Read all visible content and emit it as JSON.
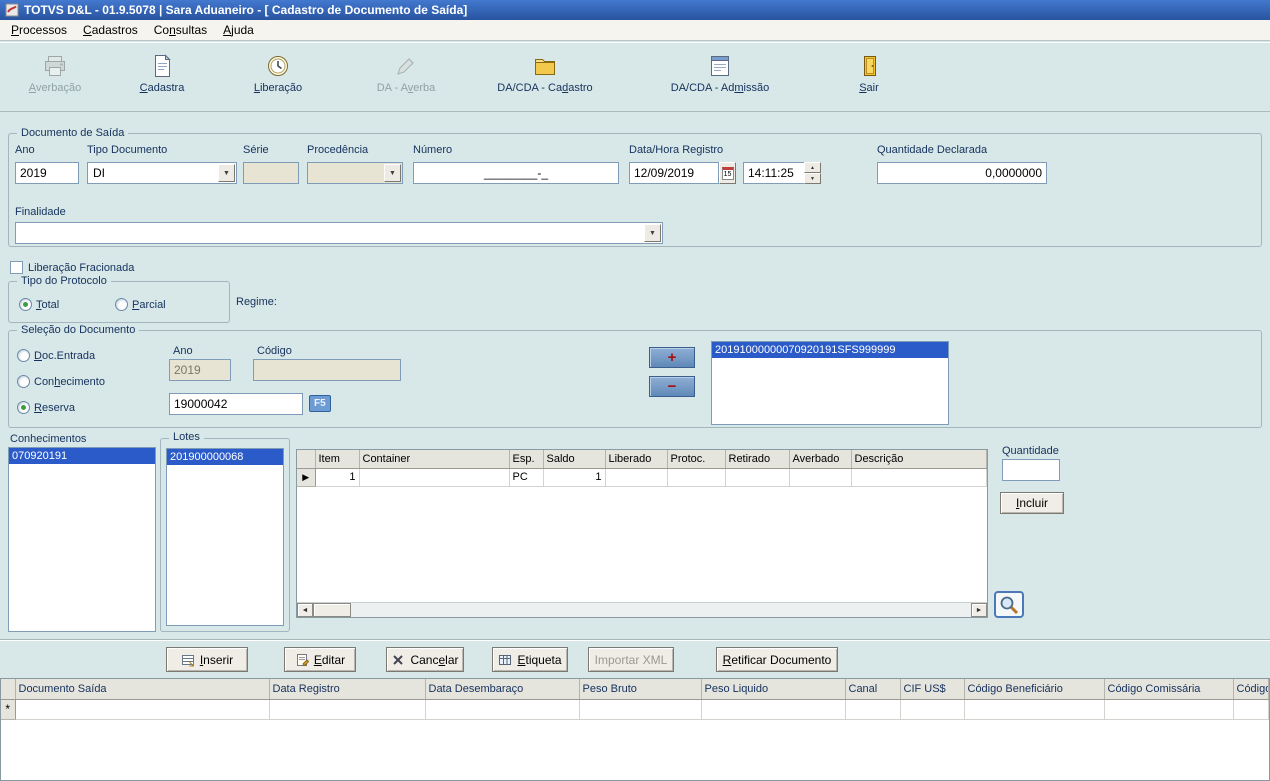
{
  "icons": {
    "dropdown_arrow": "▼",
    "spin_up": "▲",
    "spin_down": "▼",
    "scroll_left": "◄",
    "scroll_right": "►",
    "row_marker": "▶"
  },
  "window": {
    "title": "TOTVS D&L - 01.9.5078 | Sara Aduaneiro - [ Cadastro de Documento de Saída]"
  },
  "menubar": {
    "items": [
      {
        "label": "Processos",
        "hotkey": 0
      },
      {
        "label": "Cadastros",
        "hotkey": 0
      },
      {
        "label": "Consultas",
        "hotkey": 2
      },
      {
        "label": "Ajuda",
        "hotkey": 0
      }
    ]
  },
  "toolbar": {
    "buttons": [
      {
        "label": "Averbação",
        "hotkey": 0,
        "disabled": true
      },
      {
        "label": "Cadastra",
        "hotkey": 0,
        "disabled": false
      },
      {
        "label": "Liberação",
        "hotkey": 0,
        "disabled": false
      },
      {
        "label": "DA - Averba",
        "hotkey": 6,
        "disabled": true
      },
      {
        "label": "DA/CDA - Cadastro",
        "hotkey": 11,
        "disabled": false
      },
      {
        "label": "DA/CDA - Admissão",
        "hotkey": 11,
        "disabled": false
      },
      {
        "label": "Sair",
        "hotkey": 0,
        "disabled": false
      }
    ]
  },
  "documento_saida": {
    "group_title": "Documento de Saída",
    "ano_label": "Ano",
    "ano_value": "2019",
    "tipo_documento_label": "Tipo Documento",
    "tipo_documento_value": "DI",
    "serie_label": "Série",
    "serie_value": "",
    "procedencia_label": "Procedência",
    "procedencia_value": "",
    "numero_label": "Número",
    "numero_value": "________-_",
    "data_hora_label": "Data/Hora Registro",
    "data_value": "12/09/2019",
    "calendar_button_label": "15",
    "hora_value": "14:11:25",
    "quantidade_declarada_label": "Quantidade Declarada",
    "quantidade_declarada_value": "0,0000000",
    "finalidade_label": "Finalidade",
    "finalidade_value": ""
  },
  "liberacao_fracionada": {
    "label": "Liberação Fracionada",
    "checked": false
  },
  "tipo_protocolo": {
    "group_title": "Tipo do Protocolo",
    "options": [
      {
        "label": "Total",
        "hotkey": 0,
        "selected": true
      },
      {
        "label": "Parcial",
        "hotkey": 0,
        "selected": false
      }
    ],
    "regime_label": "Regime:"
  },
  "selecao_documento": {
    "group_title": "Seleção do Documento",
    "options": [
      {
        "label": "Doc.Entrada",
        "hotkey": 0,
        "selected": false
      },
      {
        "label": "Conhecimento",
        "hotkey": 3,
        "selected": false
      },
      {
        "label": "Reserva",
        "hotkey": 0,
        "selected": true
      }
    ],
    "ano_label": "Ano",
    "ano_value": "2019",
    "codigo_label": "Código",
    "codigo_value": "",
    "reserva_value": "19000042",
    "f5_button_label": "F5",
    "add_button_label": "+",
    "remove_button_label": "−",
    "documents": [
      "20191000000070920191SFS999999"
    ]
  },
  "conhecimentos": {
    "label": "Conhecimentos",
    "items": [
      "070920191"
    ]
  },
  "lotes": {
    "group_title": "Lotes",
    "items": [
      "201900000068"
    ]
  },
  "itens_grid": {
    "columns": [
      "Item",
      "Container",
      "Esp.",
      "Saldo",
      "Liberado",
      "Protoc.",
      "Retirado",
      "Averbado",
      "Descrição"
    ],
    "rows": [
      {
        "item": "1",
        "container": "",
        "esp": "PC",
        "saldo": "1",
        "liberado": "",
        "protoc": "",
        "retirado": "",
        "averbado": "",
        "descricao": ""
      }
    ]
  },
  "quantidade_panel": {
    "label": "Quantidade",
    "value": "",
    "incluir_label": "Incluir",
    "incluir_hotkey": 0
  },
  "actions": {
    "buttons": [
      {
        "label": "Inserir",
        "hotkey": 0,
        "disabled": false
      },
      {
        "label": "Editar",
        "hotkey": 0,
        "disabled": false
      },
      {
        "label": "Cancelar",
        "hotkey": 4,
        "disabled": false
      },
      {
        "label": "Etiqueta",
        "hotkey": 0,
        "disabled": false
      },
      {
        "label": "Importar XML",
        "disabled": true
      },
      {
        "label": "Retificar Documento",
        "hotkey": 0,
        "disabled": false
      }
    ]
  },
  "bottom_grid": {
    "columns": [
      "Documento Saída",
      "Data Registro",
      "Data Desembaraço",
      "Peso Bruto",
      "Peso Liquido",
      "Canal",
      "CIF US$",
      "Código Beneficiário",
      "Código Comissária",
      "Código"
    ],
    "new_row_marker": "*"
  }
}
